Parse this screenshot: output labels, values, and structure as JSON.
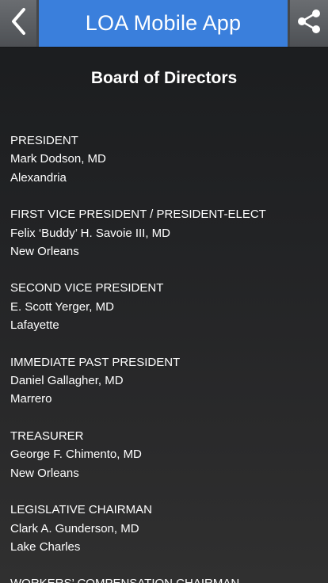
{
  "header": {
    "title": "LOA Mobile App",
    "back_icon": "chevron-left-icon",
    "share_icon": "share-icon"
  },
  "page": {
    "title": "Board of Directors"
  },
  "officers": [
    {
      "role": "PRESIDENT",
      "name": "Mark Dodson, MD",
      "city": "Alexandria"
    },
    {
      "role": "FIRST VICE PRESIDENT / PRESIDENT-ELECT",
      "name": "Felix ‘Buddy’ H. Savoie III, MD",
      "city": "New Orleans"
    },
    {
      "role": "SECOND VICE PRESIDENT",
      "name": "E. Scott Yerger, MD",
      "city": "Lafayette"
    },
    {
      "role": "IMMEDIATE PAST PRESIDENT",
      "name": "Daniel Gallagher, MD",
      "city": "Marrero"
    },
    {
      "role": "TREASURER",
      "name": "George F. Chimento, MD",
      "city": "New Orleans"
    },
    {
      "role": "LEGISLATIVE CHAIRMAN",
      "name": "Clark A. Gunderson, MD",
      "city": "Lake Charles"
    },
    {
      "role": "WORKERS’ COMPENSATION CHAIRMAN",
      "name": "",
      "city": ""
    }
  ],
  "colors": {
    "title_bar": "#3a7fdc",
    "toolbar_button": "#5b5e62",
    "background": "#222325",
    "text": "#ffffff"
  }
}
